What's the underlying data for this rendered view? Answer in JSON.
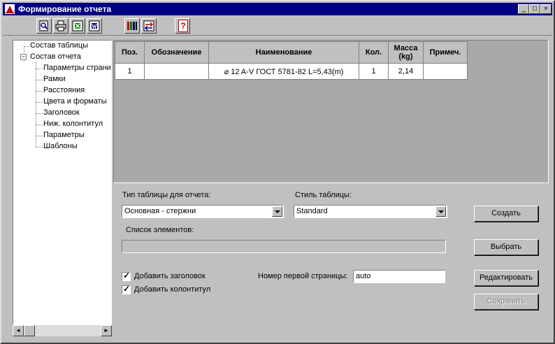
{
  "window": {
    "title": "Формирование отчета"
  },
  "titlebar_buttons": {
    "minimize": "_",
    "maximize": "□",
    "close": "×"
  },
  "toolbar": {
    "icons": [
      "preview-icon",
      "print-icon",
      "export-excel-icon",
      "export-word-icon",
      "columns-icon",
      "swap-icon",
      "help-icon"
    ],
    "help_label": "?"
  },
  "tree": {
    "items": [
      {
        "label": "Состав таблицы"
      },
      {
        "label": "Состав отчета"
      },
      {
        "label": "Параметры страни"
      },
      {
        "label": "Рамки"
      },
      {
        "label": "Расстояния"
      },
      {
        "label": "Цвета и форматы"
      },
      {
        "label": "Заголовок"
      },
      {
        "label": "Ниж. колонтитул"
      },
      {
        "label": "Параметры"
      },
      {
        "label": "Шаблоны"
      }
    ],
    "expander": "−"
  },
  "scrollbar": {
    "left_arrow": "◄",
    "right_arrow": "►"
  },
  "grid": {
    "headers": [
      "Поз.",
      "Обозначение",
      "Наименование",
      "Кол.",
      "Масса\n(kg)",
      "Примеч."
    ],
    "rows": [
      [
        "1",
        "",
        "⌀ 12 A-V ГОСТ 5781-82 L=5,43(m)",
        "1",
        "2,14",
        ""
      ]
    ]
  },
  "form": {
    "table_type_label": "Тип таблицы для отчета:",
    "table_type_value": "Основная - стержни",
    "table_style_label": "Стиль таблицы:",
    "table_style_value": "Standard",
    "elements_label": "Список элементов:",
    "add_header_label": "Добавить заголовок",
    "add_footer_label": "Добавить колонтитул",
    "first_page_label": "Номер первой страницы:",
    "first_page_value": "auto"
  },
  "buttons": {
    "create": "Создать",
    "select": "Выбрать",
    "edit": "Редактировать",
    "save": "Сохранить"
  }
}
